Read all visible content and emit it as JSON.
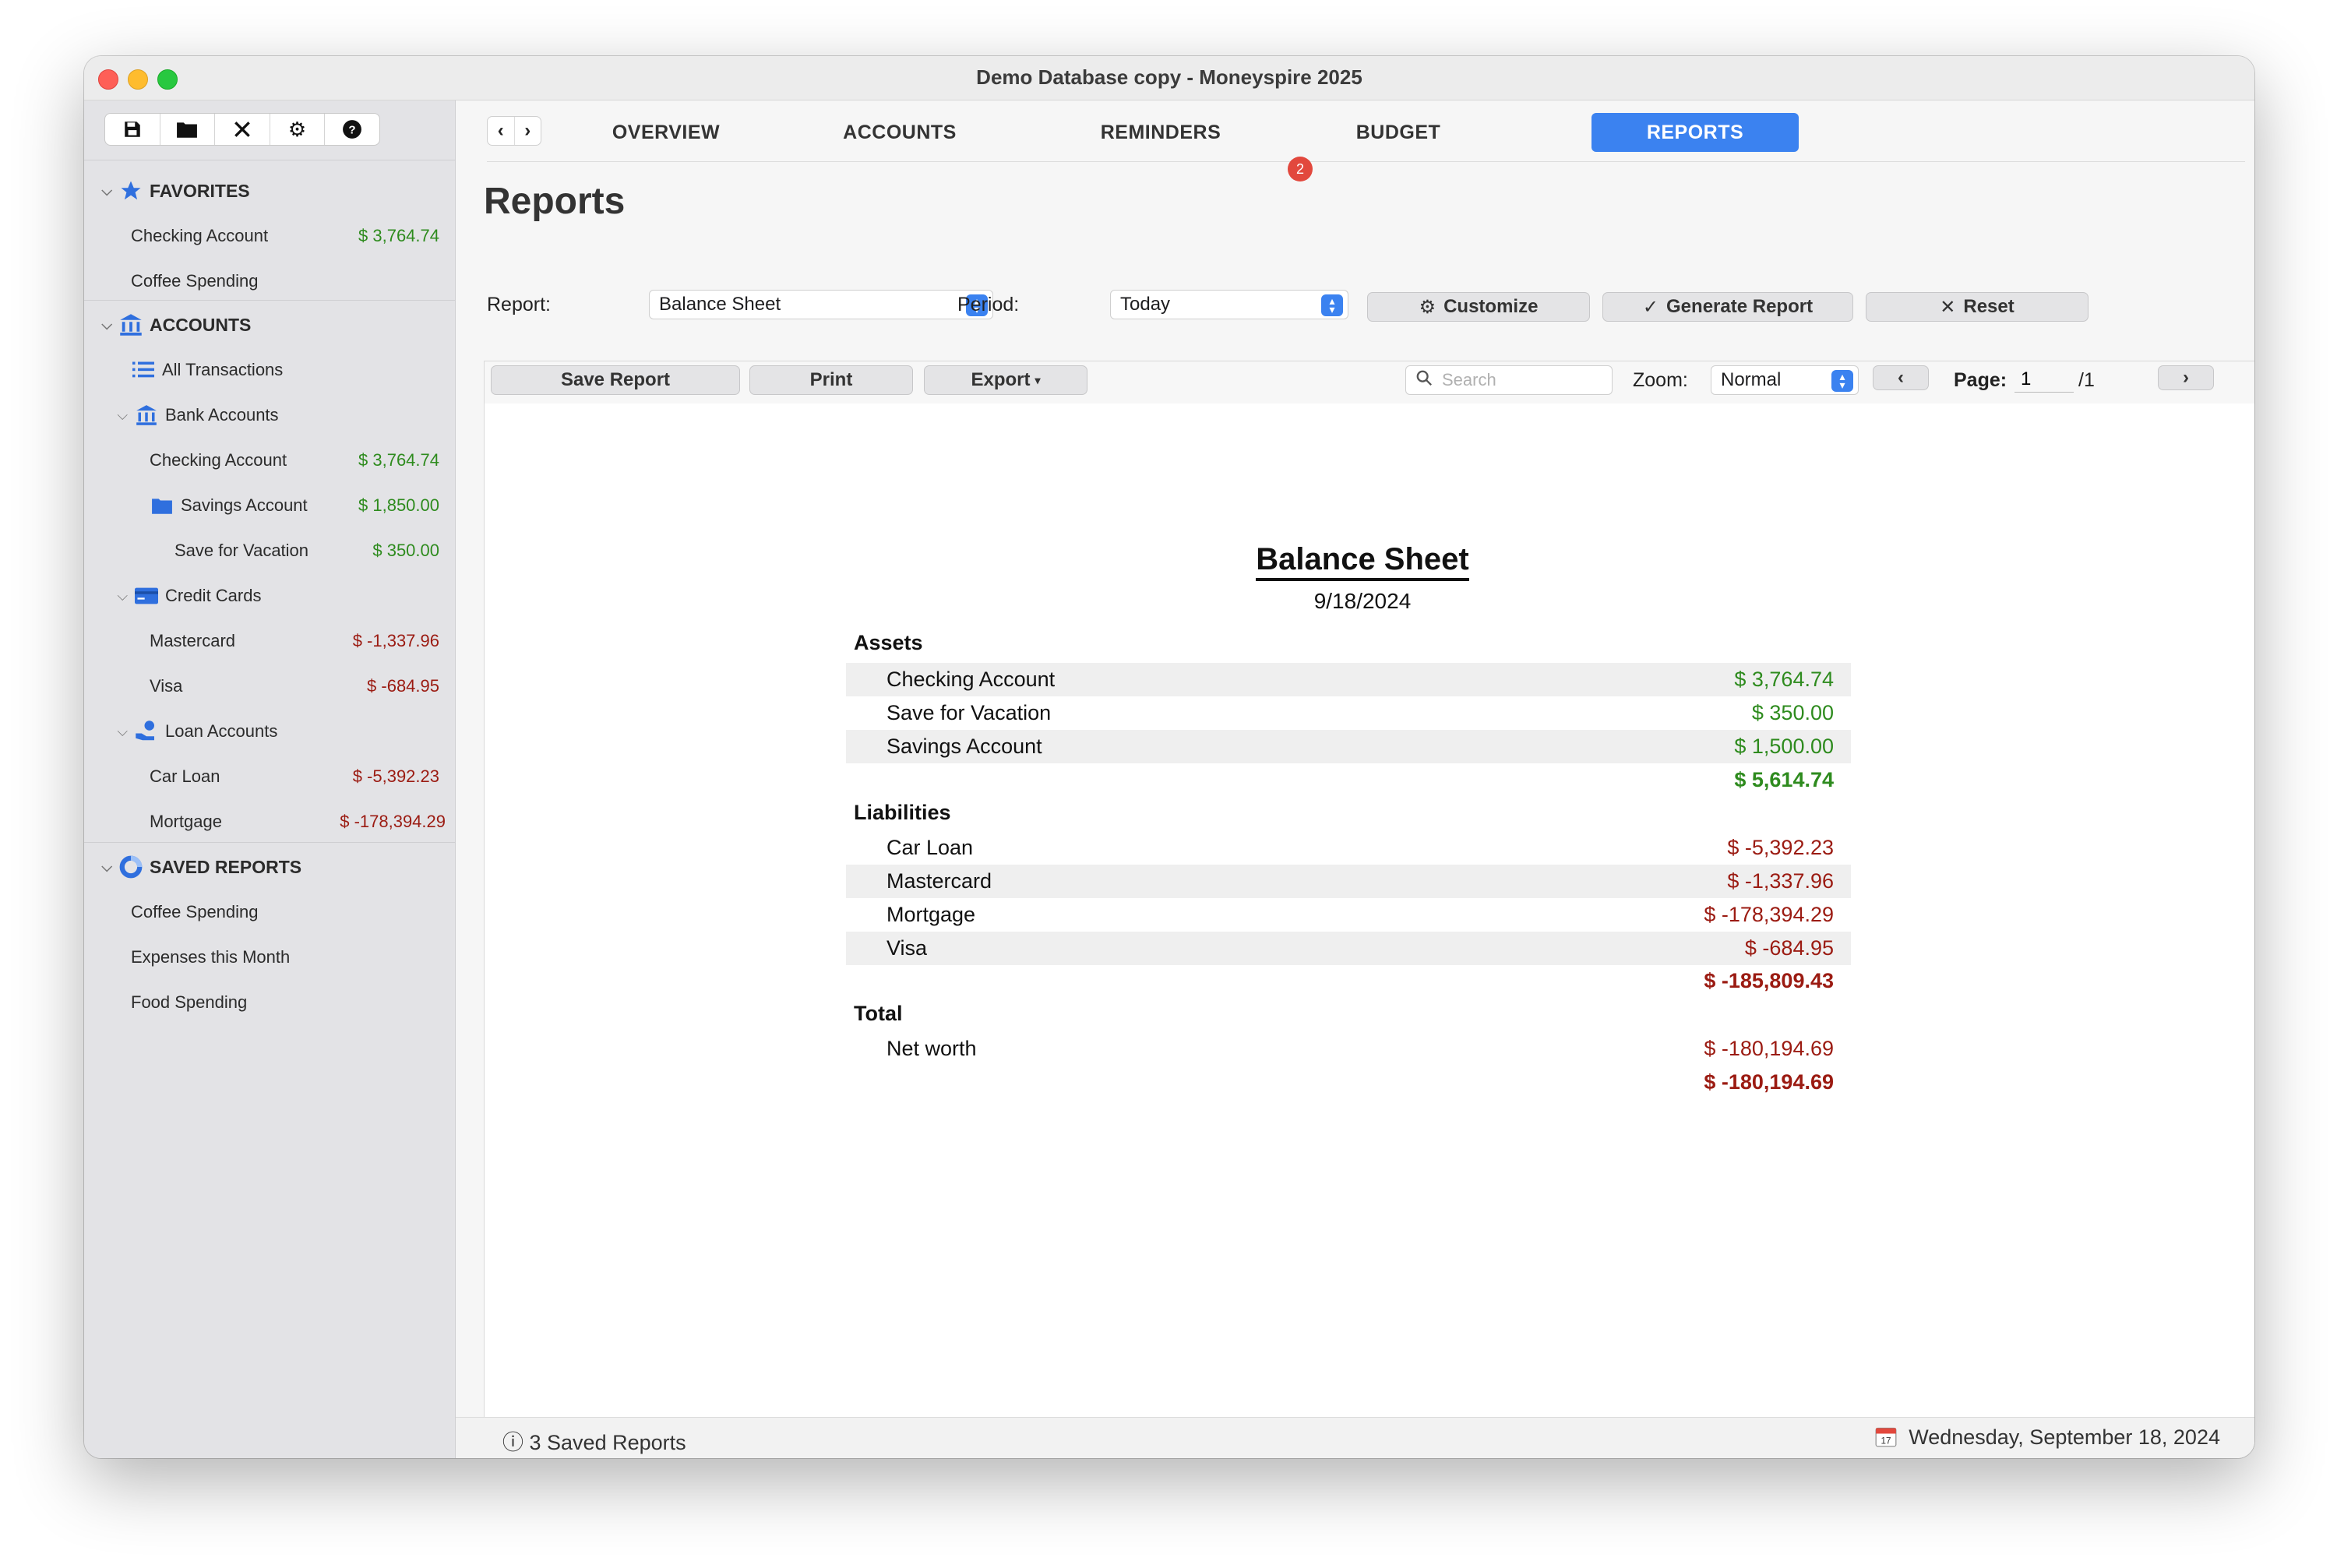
{
  "window": {
    "title": "Demo Database copy - Moneyspire 2025"
  },
  "toolbar": {
    "icons": [
      "save-icon",
      "folder-icon",
      "tools-icon",
      "gear-icon",
      "help-icon"
    ]
  },
  "sidebar": {
    "favorites": {
      "label": "FAVORITES",
      "items": [
        {
          "label": "Checking Account",
          "amount": "$ 3,764.74"
        },
        {
          "label": "Coffee Spending",
          "amount": ""
        }
      ]
    },
    "accounts": {
      "label": "ACCOUNTS",
      "all_transactions": "All Transactions",
      "bank": {
        "label": "Bank Accounts",
        "items": [
          {
            "label": "Checking Account",
            "amount": "$ 3,764.74"
          },
          {
            "label": "Savings Account",
            "amount": "$ 1,850.00"
          },
          {
            "label": "Save for Vacation",
            "amount": "$ 350.00"
          }
        ]
      },
      "credit": {
        "label": "Credit Cards",
        "items": [
          {
            "label": "Mastercard",
            "amount": "$ -1,337.96"
          },
          {
            "label": "Visa",
            "amount": "$ -684.95"
          }
        ]
      },
      "loan": {
        "label": "Loan Accounts",
        "items": [
          {
            "label": "Car Loan",
            "amount": "$ -5,392.23"
          },
          {
            "label": "Mortgage",
            "amount": "$ -178,394.29"
          }
        ]
      }
    },
    "saved_reports": {
      "label": "SAVED REPORTS",
      "items": [
        "Coffee Spending",
        "Expenses this Month",
        "Food Spending"
      ]
    }
  },
  "nav": {
    "tabs": [
      "OVERVIEW",
      "ACCOUNTS",
      "REMINDERS",
      "BUDGET",
      "REPORTS"
    ],
    "active": "REPORTS",
    "reminders_badge": "2"
  },
  "page": {
    "title": "Reports"
  },
  "controls": {
    "report_label": "Report:",
    "report_value": "Balance Sheet",
    "period_label": "Period:",
    "period_value": "Today",
    "customize": "Customize",
    "generate": "Generate Report",
    "reset": "Reset"
  },
  "report_toolbar": {
    "save": "Save Report",
    "print": "Print",
    "export": "Export",
    "search_placeholder": "Search",
    "zoom_label": "Zoom:",
    "zoom_value": "Normal",
    "page_label": "Page:",
    "page_value": "1",
    "page_total": "/1"
  },
  "report": {
    "title": "Balance Sheet",
    "date": "9/18/2024",
    "sections": [
      {
        "heading": "Assets",
        "rows": [
          {
            "label": "Checking Account",
            "amount": "$ 3,764.74"
          },
          {
            "label": "Save for Vacation",
            "amount": "$ 350.00"
          },
          {
            "label": "Savings Account",
            "amount": "$ 1,500.00"
          }
        ],
        "total": "$ 5,614.74"
      },
      {
        "heading": "Liabilities",
        "rows": [
          {
            "label": "Car Loan",
            "amount": "$ -5,392.23"
          },
          {
            "label": "Mastercard",
            "amount": "$ -1,337.96"
          },
          {
            "label": "Mortgage",
            "amount": "$ -178,394.29"
          },
          {
            "label": "Visa",
            "amount": "$ -684.95"
          }
        ],
        "total": "$ -185,809.43"
      },
      {
        "heading": "Total",
        "rows": [
          {
            "label": "Net worth",
            "amount": "$ -180,194.69"
          }
        ],
        "total": "$ -180,194.69"
      }
    ]
  },
  "status": {
    "left": "3 Saved Reports",
    "right": "Wednesday, September 18, 2024"
  },
  "colors": {
    "accent": "#3b82f0",
    "positive": "#2e8b1e",
    "negative": "#9b1b12",
    "badge": "#e2483d"
  }
}
